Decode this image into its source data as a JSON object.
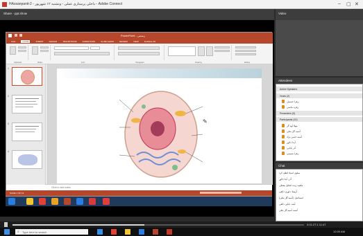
{
  "window": {
    "title": "HAssanpanit-2 - داخلی پرستاری عملی - ونشنبه ۱۲ شهریور - Adobe Connect"
  },
  "share": {
    "title": "Share - ppt.show"
  },
  "video": {
    "title": "Video"
  },
  "ppt": {
    "title": "PowerPoint - زیستی",
    "tabs": [
      "FILE",
      "HOME",
      "INSERT",
      "DESIGN",
      "TRANSITIONS",
      "ANIMATIONS",
      "SLIDE SHOW",
      "REVIEW",
      "VIEW",
      "EndNote X6"
    ],
    "ribbon_groups": [
      "Clipboard",
      "Slides",
      "Font",
      "Paragraph",
      "Drawing",
      "Editing"
    ],
    "slide_numbers": [
      "1",
      "2",
      "3",
      "4"
    ],
    "notes_placeholder": "Click to add notes",
    "status": "SLIDE 1 OF 12"
  },
  "attendees": {
    "title": "Attendees",
    "header_active": "Active Speakers",
    "hosts_label": "Hosts (2)",
    "hosts": [
      "زهرا حسنیل",
      "زهره نیاسی"
    ],
    "presenters_label": "Presenters (0)",
    "participants_label": "Participants (10)",
    "participants": [
      "مهلا آوه گر",
      "آسیه گل بطی",
      "آنسه حسن نژاد",
      "آیدا دلاور",
      "آذر بابایی",
      "زهرا نسیمی"
    ]
  },
  "chat": {
    "title": "Chat",
    "lines": [
      "سلوی  استاد لطف کرد",
      "آذر: آیدا دلاور",
      "ماهیه: ژنده انجلبل معطی",
      "آرمیتا: داوری ذائقی",
      "اسماعیل: (آسیه گل بطی)",
      "آمنه: بابایی ذائقی",
      "آنسه: آسیه گل بطی"
    ]
  },
  "playback": {
    "time": "0:01:27:1 11:47"
  },
  "taskbar": {
    "search_placeholder": "Type here to search",
    "clock": "12:00 AM"
  }
}
